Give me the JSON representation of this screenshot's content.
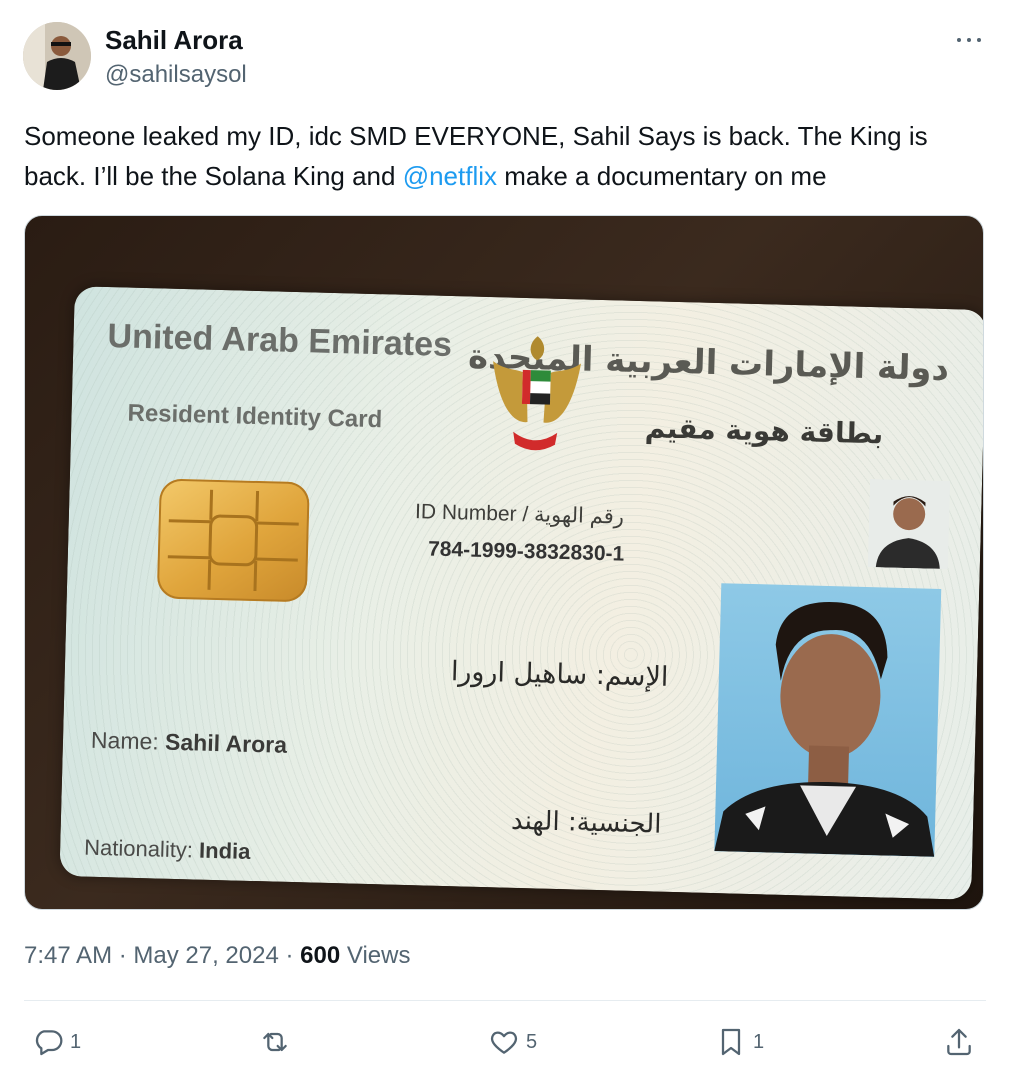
{
  "author": {
    "display_name": "Sahil Arora",
    "handle": "@sahilsaysol",
    "avatar_icon": "person-avatar"
  },
  "tweet": {
    "text_before": "Someone leaked my ID, idc SMD EVERYONE, Sahil Says is back. The King is back. I’ll be the Solana King and ",
    "mention": "@netflix",
    "text_after": " make a documentary on me"
  },
  "id_card": {
    "country_en": "United Arab Emirates",
    "card_type_en": "Resident Identity Card",
    "country_ar": "دولة الإمارات العربية المتحدة",
    "card_type_ar": "بطاقة هوية مقيم",
    "id_label": "ID Number / رقم الهوية",
    "id_number": "784-1999-3832830-1",
    "name_ar": "الإسم: ساهيل ارورا",
    "name_label": "Name:",
    "name_value": "Sahil Arora",
    "nationality_ar": "الجنسية: الهند",
    "nationality_label": "Nationality:",
    "nationality_value": "India"
  },
  "meta": {
    "time": "7:47 AM",
    "sep1": " · ",
    "date": "May 27, 2024",
    "sep2": " · ",
    "views_count": "600",
    "views_label": " Views"
  },
  "actions": {
    "reply_count": "1",
    "retweet_count": "",
    "like_count": "5",
    "bookmark_count": "1"
  },
  "colors": {
    "link": "#1d9bf0",
    "secondary_text": "#536471",
    "primary_text": "#0f1419"
  }
}
